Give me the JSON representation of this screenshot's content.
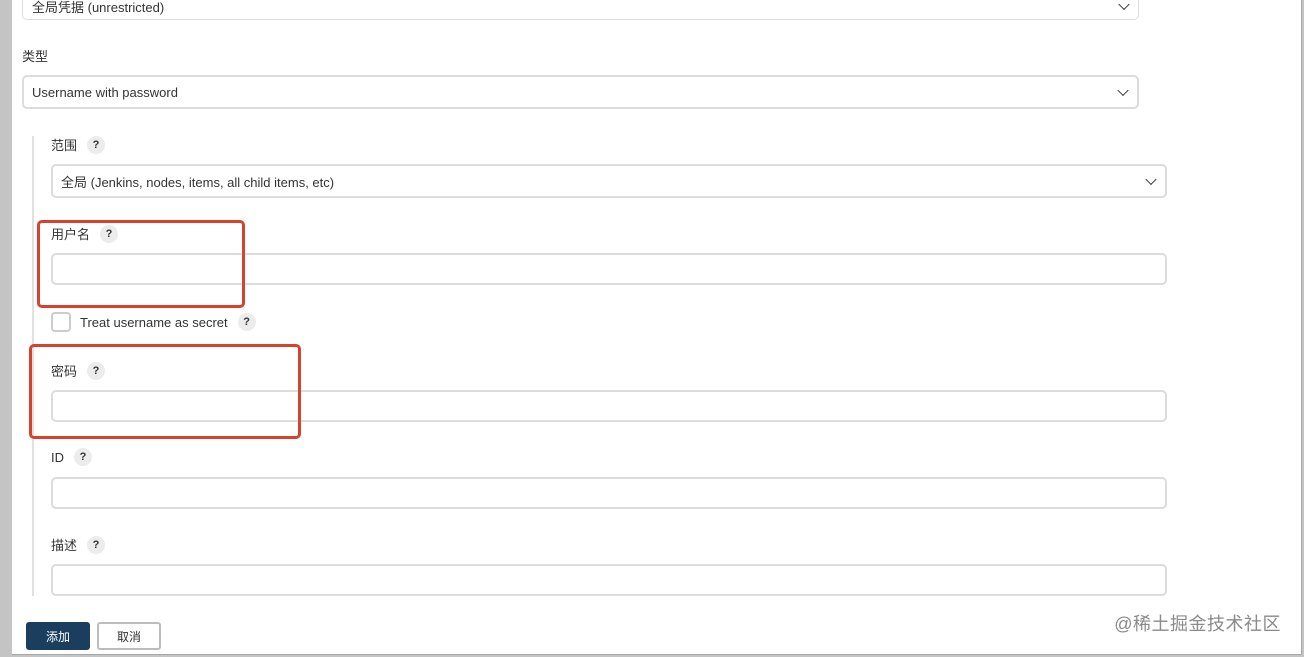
{
  "form": {
    "domain_select": {
      "value": "全局凭据 (unrestricted)"
    },
    "kind": {
      "label": "类型",
      "value": "Username with password"
    },
    "scope": {
      "label": "范围",
      "help": "?",
      "value": "全局 (Jenkins, nodes, items, all child items, etc)"
    },
    "username": {
      "label": "用户名",
      "help": "?",
      "value": ""
    },
    "username_secret": {
      "label": "Treat username as secret",
      "help": "?",
      "checked": false
    },
    "password": {
      "label": "密码",
      "help": "?",
      "value": ""
    },
    "id": {
      "label": "ID",
      "help": "?",
      "value": ""
    },
    "description": {
      "label": "描述",
      "help": "?",
      "value": ""
    }
  },
  "actions": {
    "add_label": "添加",
    "cancel_label": "取消"
  },
  "highlight_color": "#d9412f",
  "primary_color": "#1c3e5e",
  "watermark": "@稀土掘金技术社区"
}
